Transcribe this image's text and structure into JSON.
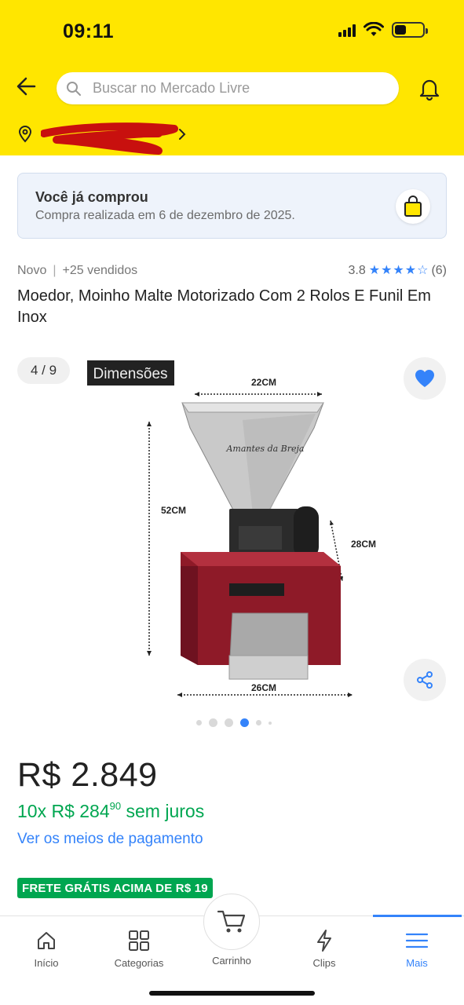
{
  "status_bar": {
    "time": "09:11"
  },
  "header": {
    "search_placeholder": "Buscar no Mercado Livre",
    "icons": [
      "back-arrow-icon",
      "search-icon",
      "bell-icon",
      "location-pin-icon",
      "chevron-right-icon"
    ],
    "accent_color": "#FFE600"
  },
  "purchase_notice": {
    "title": "Você já comprou",
    "subtitle": "Compra realizada em 6 de dezembro de 2025.",
    "icon": "shopping-bag-icon"
  },
  "product": {
    "condition": "Novo",
    "separator": "|",
    "sold": "+25 vendidos",
    "rating_value": "3.8",
    "rating_count": "(6)",
    "stars_filled": 4,
    "stars_total": 5,
    "title": "Moedor, Moinho Malte Motorizado Com 2 Rolos E Funil Em Inox"
  },
  "gallery": {
    "counter": "4 / 9",
    "image_caption": "Dimensões",
    "dimensions": {
      "width_top": "22CM",
      "height": "52CM",
      "depth": "28CM",
      "width_base": "26CM"
    },
    "brand_logo_text": "Amantes da Breja",
    "dots_total": 6,
    "active_dot": 4
  },
  "pricing": {
    "price": "R$ 2.849",
    "installments_prefix": "10x R$ 284",
    "installments_cents": "90",
    "installments_suffix": "sem juros",
    "payment_link": "Ver os meios de pagamento",
    "shipping_badge": "FRETE GRÁTIS ACIMA DE R$ 19",
    "price_color": "#00A650",
    "link_color": "#3483FA"
  },
  "bottom_nav": {
    "items": [
      {
        "label": "Início",
        "icon": "home-icon"
      },
      {
        "label": "Categorias",
        "icon": "grid-icon"
      },
      {
        "label": "Carrinho",
        "icon": "cart-icon"
      },
      {
        "label": "Clips",
        "icon": "lightning-icon"
      },
      {
        "label": "Mais",
        "icon": "menu-icon"
      }
    ],
    "active": "Mais"
  }
}
